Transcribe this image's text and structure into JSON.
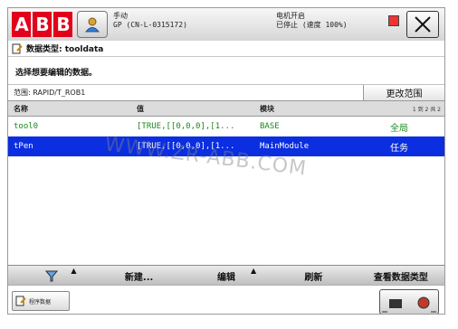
{
  "header": {
    "logo": [
      "A",
      "B",
      "B"
    ],
    "status_left_line1": "手动",
    "status_left_line2": "GP (CN-L-0315172)",
    "status_right_line1": "电机开启",
    "status_right_line2": "已停止 (速度 100%)"
  },
  "window": {
    "title": "数据类型: tooldata"
  },
  "prompt": "选择想要编辑的数据。",
  "scope": {
    "label": "范围: RAPID/T_ROB1",
    "button": "更改范围"
  },
  "table": {
    "columns": [
      "名称",
      "值",
      "模块"
    ],
    "page_info": "1 到 2 共 2",
    "rows": [
      {
        "name": "tool0",
        "value": "[TRUE,[[0,0,0],[1...",
        "module": "BASE",
        "scope": "全局",
        "selected": false
      },
      {
        "name": "tPen",
        "value": "[TRUE,[[0,0,0],[1...",
        "module": "MainModule",
        "scope": "任务",
        "selected": true
      }
    ]
  },
  "watermark": "WWW.ZR-ABB.COM",
  "commands": {
    "new": "新建...",
    "edit": "编辑",
    "refresh": "刷新",
    "view_type": "查看数据类型"
  },
  "taskbar": {
    "task_label": "程序数据"
  },
  "colors": {
    "abb_red": "#e2001a",
    "selected_row": "#0a2ee0",
    "row_text": "#1a8a1a"
  }
}
